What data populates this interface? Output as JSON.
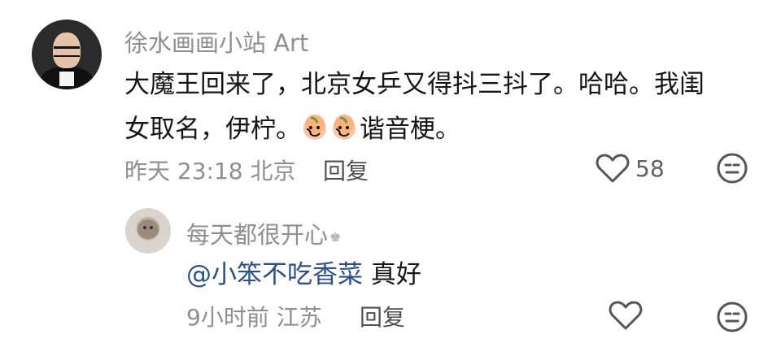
{
  "comment": {
    "username": "徐水画画小站 Art",
    "text_line1": "大魔王回来了，北京女乒又得抖三抖了。哈哈。我闺",
    "text_line2a": "女取名，伊柠。",
    "emoji_names": [
      "peach-face-emoji",
      "peach-face-emoji"
    ],
    "text_line2b": "谐音梗。",
    "time": "昨天 23:18",
    "location": "北京",
    "reply_label": "回复",
    "like_count": "58",
    "icons": {
      "like": "heart-outline-icon",
      "dislike": "neutral-face-icon"
    }
  },
  "reply": {
    "username": "每天都很开心",
    "badge_icon": "crown-badge-icon",
    "mention": "@小笨不吃香菜",
    "text": " 真好",
    "time": "9小时前",
    "location": "江苏",
    "reply_label": "回复",
    "icons": {
      "like": "heart-outline-icon",
      "dislike": "neutral-face-icon"
    }
  },
  "colors": {
    "username": "#8e8e93",
    "text": "#161616",
    "mention": "#2d4e86",
    "icon": "#555555"
  }
}
